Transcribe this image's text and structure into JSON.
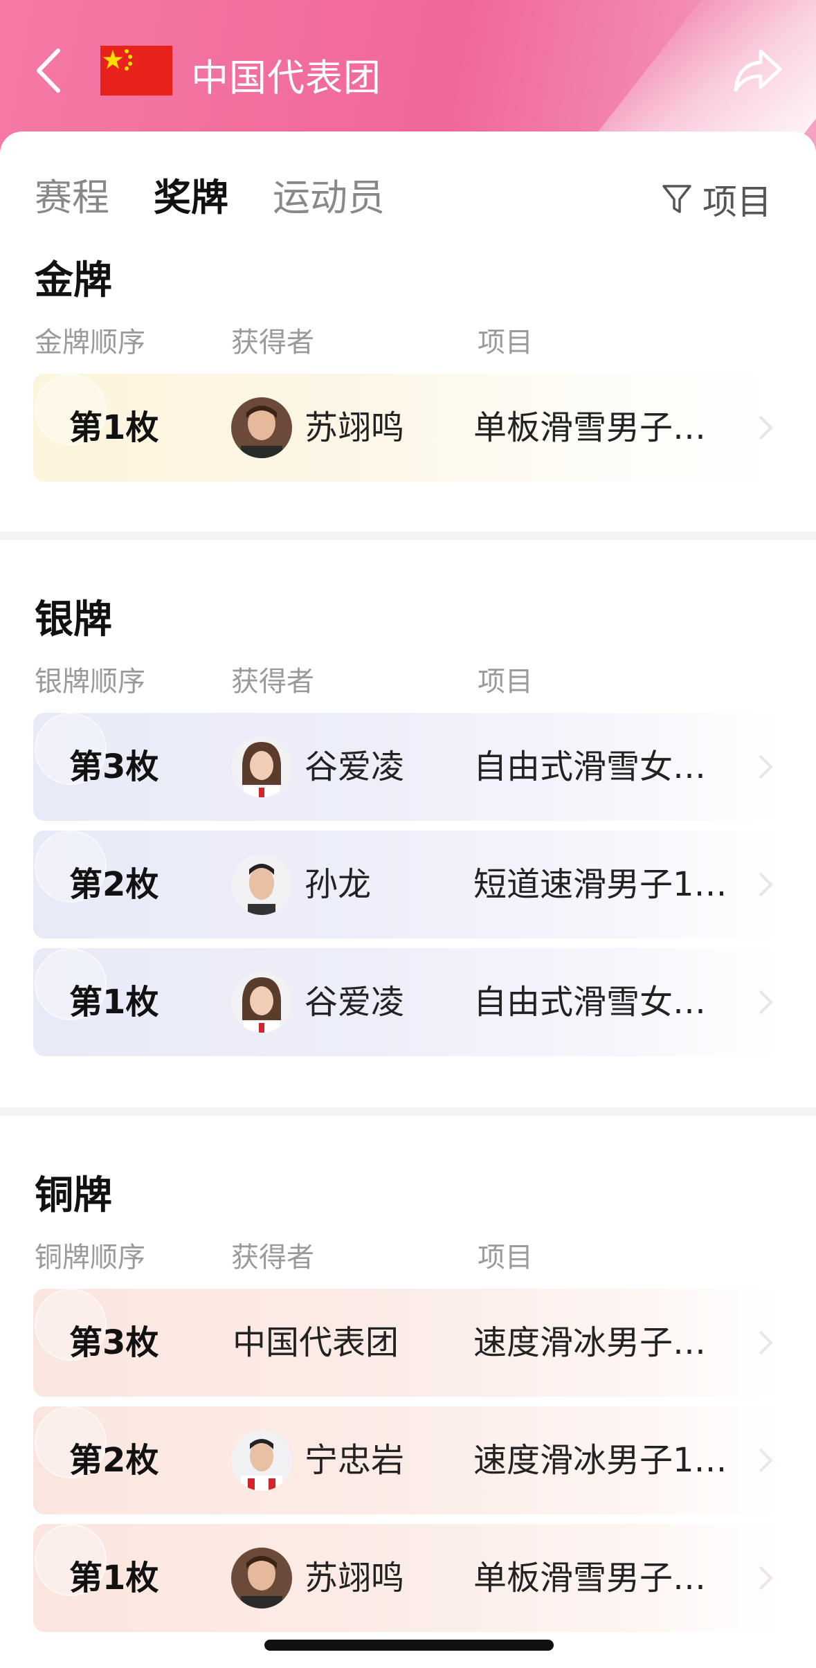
{
  "header": {
    "title": "中国代表团",
    "back_icon": "chevron-left-icon",
    "share_icon": "share-arrow-icon",
    "flag_colors": {
      "field": "#e8231c",
      "stars": "#ffde00"
    }
  },
  "tabs": [
    {
      "label": "赛程",
      "active": false
    },
    {
      "label": "奖牌",
      "active": true
    },
    {
      "label": "运动员",
      "active": false
    }
  ],
  "filter": {
    "label": "项目",
    "icon": "filter-funnel-icon"
  },
  "columns": {
    "winner": "获得者",
    "event": "项目"
  },
  "sections": {
    "gold": {
      "title": "金牌",
      "order_header": "金牌顺序",
      "rows": [
        {
          "order": "第1枚",
          "winner": "苏翊鸣",
          "event": "单板滑雪男子…",
          "has_avatar": true
        }
      ]
    },
    "silver": {
      "title": "银牌",
      "order_header": "银牌顺序",
      "rows": [
        {
          "order": "第3枚",
          "winner": "谷爱凌",
          "event": "自由式滑雪女…",
          "has_avatar": true
        },
        {
          "order": "第2枚",
          "winner": "孙龙",
          "event": "短道速滑男子1…",
          "has_avatar": true
        },
        {
          "order": "第1枚",
          "winner": "谷爱凌",
          "event": "自由式滑雪女…",
          "has_avatar": true
        }
      ]
    },
    "bronze": {
      "title": "铜牌",
      "order_header": "铜牌顺序",
      "rows": [
        {
          "order": "第3枚",
          "winner": "中国代表团",
          "event": "速度滑冰男子…",
          "has_avatar": false
        },
        {
          "order": "第2枚",
          "winner": "宁忠岩",
          "event": "速度滑冰男子1…",
          "has_avatar": true
        },
        {
          "order": "第1枚",
          "winner": "苏翊鸣",
          "event": "单板滑雪男子…",
          "has_avatar": true
        }
      ]
    }
  },
  "colors": {
    "header_pink": "#f0679a",
    "gold_row": "#fdf4dc",
    "silver_row": "#e8eaf8",
    "bronze_row": "#fbe6df"
  }
}
